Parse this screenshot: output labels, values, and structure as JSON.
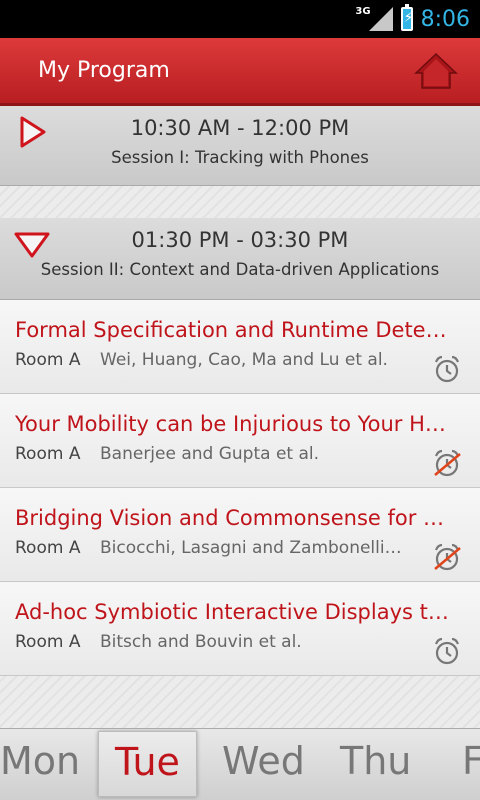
{
  "status_bar": {
    "network": "3G",
    "time": "8:06"
  },
  "action_bar": {
    "title": "My Program",
    "home_icon": "home-icon"
  },
  "sessions": [
    {
      "time_range": "10:30 AM - 12:00 PM",
      "title": "Session I: Tracking with Phones",
      "expanded": false
    },
    {
      "time_range": "01:30 PM - 03:30 PM",
      "title": "Session II: Context and Data-driven Applications",
      "expanded": true
    }
  ],
  "items": [
    {
      "title": "Formal Specification and Runtime Dete…",
      "room": "Room A",
      "authors": "Wei, Huang, Cao, Ma and Lu et al.",
      "alarm": "on"
    },
    {
      "title": "Your Mobility can be Injurious to Your H…",
      "room": "Room A",
      "authors": "Banerjee and Gupta et al.",
      "alarm": "off"
    },
    {
      "title": "Bridging Vision and Commonsense for …",
      "room": "Room A",
      "authors": "Bicocchi, Lasagni and Zambonelli…",
      "alarm": "off"
    },
    {
      "title": "Ad-hoc Symbiotic Interactive Displays t…",
      "room": "Room A",
      "authors": "Bitsch and Bouvin et al.",
      "alarm": "on"
    }
  ],
  "days": [
    "Mon",
    "Tue",
    "Wed",
    "Thu",
    "F"
  ],
  "active_day": "Tue",
  "colors": {
    "accent": "#c0141b",
    "status_time": "#33b5e5"
  }
}
